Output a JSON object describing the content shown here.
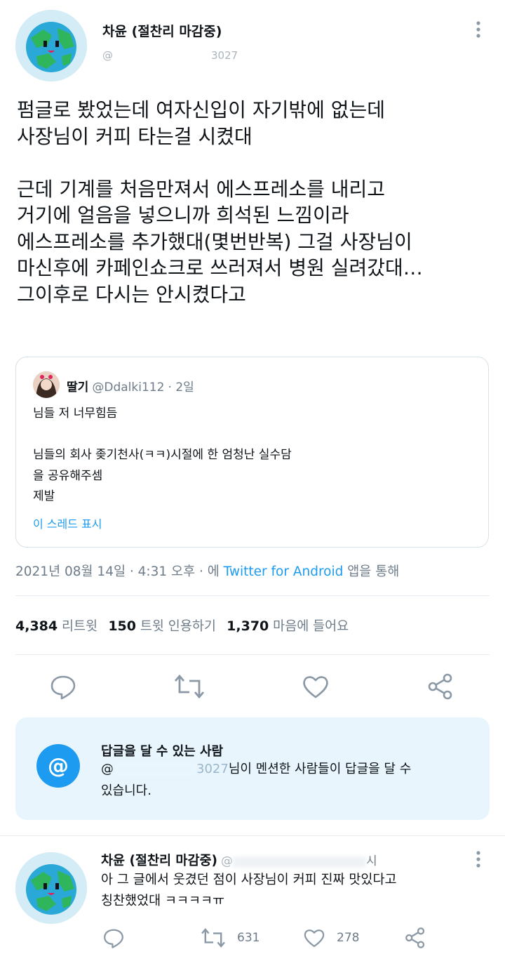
{
  "tweet": {
    "author_name": "차윤 (절찬리 마감중)",
    "handle_visible": "@",
    "handle_tail": "3027",
    "text": "펌글로 봤었는데 여자신입이 자기밖에 없는데\n사장님이 커피 타는걸 시켰대\n\n근데 기계를 처음만져서 에스프레소를 내리고\n거기에 얼음을 넣으니까 희석된 느낌이라\n에스프레소를 추가했대(몇번반복) 그걸 사장님이\n마신후에 카페인쇼크로 쓰러져서 병원 실려갔대…\n그이후로 다시는 안시켰다고",
    "more_icon": "more-vertical-icon",
    "timestamp": "2021년 08월 14일 · 4:31 오후 · 에",
    "source": "Twitter for Android",
    "source_suffix": "앱을 통해"
  },
  "quote": {
    "author_name": "딸기",
    "handle": "@Ddalki112",
    "time": "· 2일",
    "text": "님들 저 너무힘듬\n\n님들의 회사 좆기천사(ㅋㅋ)시절에 한 엄청난 실수담\n을 공유해주셈\n제발",
    "show_thread": "이 스레드 표시"
  },
  "stats": {
    "retweets_count": "4,384",
    "retweets_label": "리트윗",
    "quotes_count": "150",
    "quotes_label": "트윗 인용하기",
    "likes_count": "1,370",
    "likes_label": "마음에 들어요"
  },
  "actions": [
    "reply-icon",
    "retweet-icon",
    "like-icon",
    "share-icon"
  ],
  "reply_restriction": {
    "icon": "at-icon",
    "icon_glyph": "@",
    "title": "답글을 달 수 있는 사람",
    "handle_prefix": "@",
    "handle_partial": "3027",
    "body_line1": "님이 멘션한 사람들이 답글을 달 수",
    "body_line2": "있습니다."
  },
  "reply": {
    "author_name": "차윤 (절찬리 마감중)",
    "handle_partial": "@",
    "time_partial": "시",
    "text": "아 그 글에서 웃겼던 점이 사장님이 커피 진짜 맛있다고\n칭찬했었대 ㅋㅋㅋㅋㅠ",
    "retweet_count": "631",
    "like_count": "278"
  },
  "colors": {
    "accent": "#1d9bf0",
    "secondary_text": "#6e7c89",
    "reply_box_bg": "#e8f5fd",
    "divider": "#e6ecf0"
  }
}
